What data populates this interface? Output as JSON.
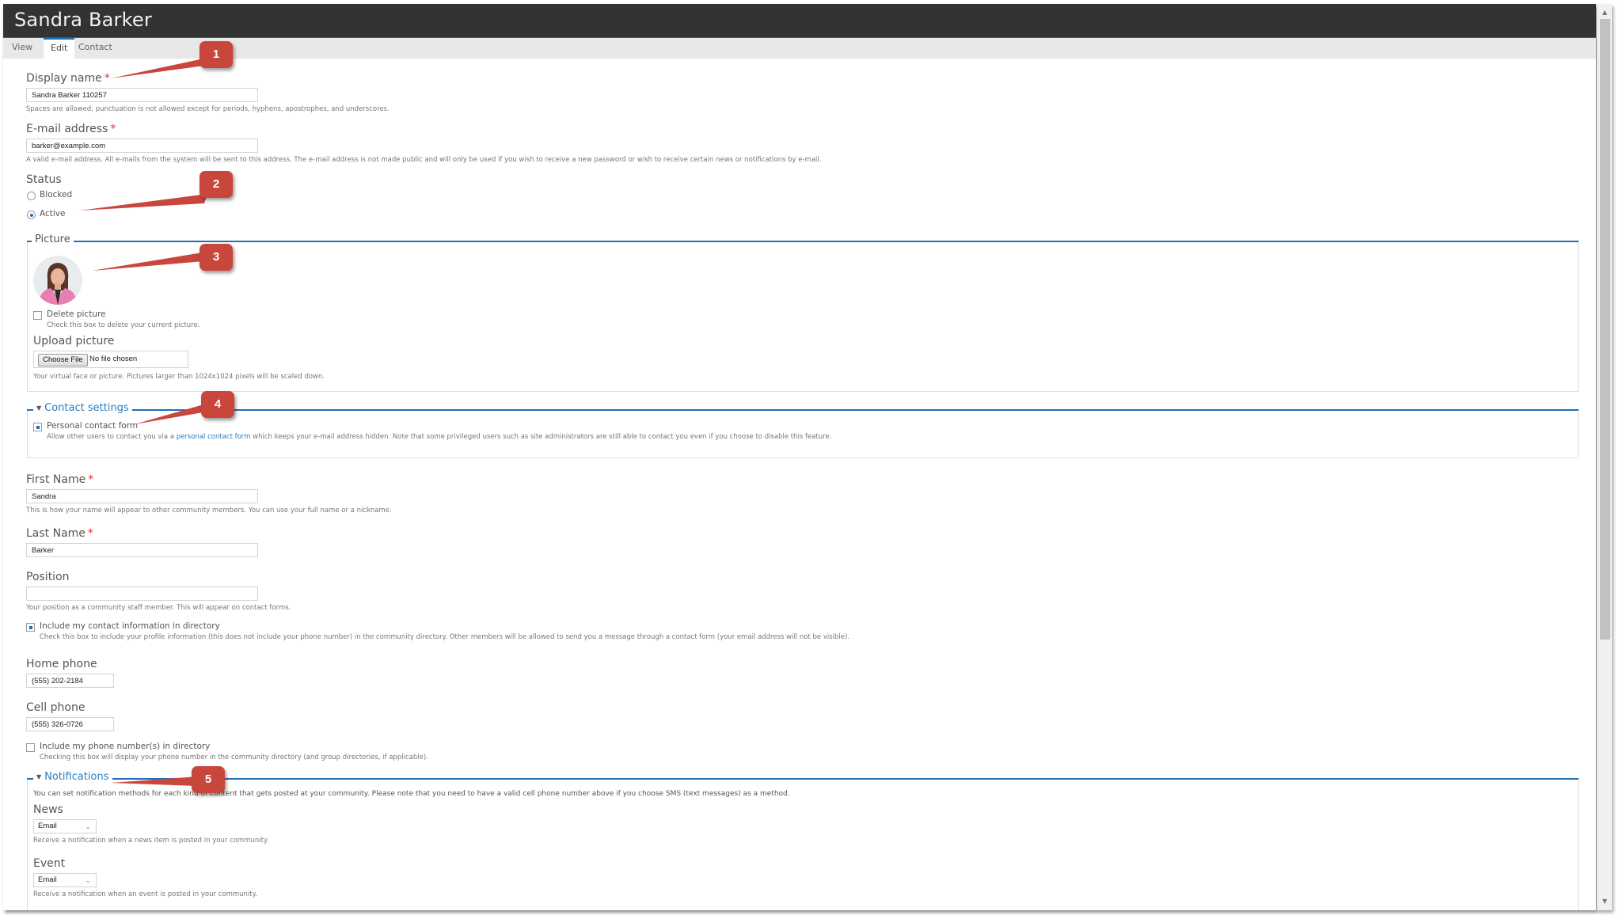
{
  "header": {
    "title": "Sandra Barker"
  },
  "tabs": [
    {
      "label": "View",
      "active": false
    },
    {
      "label": "Edit",
      "active": true
    },
    {
      "label": "Contact",
      "active": false
    }
  ],
  "form": {
    "display_name": {
      "label": "Display name",
      "required": "*",
      "value": "Sandra Barker 110257",
      "description": "Spaces are allowed; punctuation is not allowed except for periods, hyphens, apostrophes, and underscores."
    },
    "email": {
      "label": "E-mail address",
      "required": "*",
      "value": "barker@example.com",
      "description": "A valid e-mail address. All e-mails from the system will be sent to this address. The e-mail address is not made public and will only be used if you wish to receive a new password or wish to receive certain news or notifications by e-mail."
    },
    "status": {
      "label": "Status",
      "options": [
        {
          "label": "Blocked",
          "checked": false
        },
        {
          "label": "Active",
          "checked": true
        }
      ]
    },
    "picture": {
      "legend": "Picture",
      "delete_label": "Delete picture",
      "delete_checked": false,
      "delete_description": "Check this box to delete your current picture.",
      "upload_label": "Upload picture",
      "choose_button": "Choose File",
      "no_file": "No file chosen",
      "upload_description": "Your virtual face or picture. Pictures larger than 1024x1024 pixels will be scaled down."
    },
    "contact_settings": {
      "legend": "Contact settings",
      "personal_form_label": "Personal contact form",
      "personal_form_checked": true,
      "description_before": "Allow other users to contact you via a ",
      "description_link": "personal contact form",
      "description_after": " which keeps your e-mail address hidden. Note that some privileged users such as site administrators are still able to contact you even if you choose to disable this feature."
    },
    "first_name": {
      "label": "First Name",
      "required": "*",
      "value": "Sandra",
      "description": "This is how your name will appear to other community members. You can use your full name or a nickname."
    },
    "last_name": {
      "label": "Last Name",
      "required": "*",
      "value": "Barker"
    },
    "position": {
      "label": "Position",
      "value": "",
      "description": "Your position as a community staff member. This will appear on contact forms."
    },
    "include_contact": {
      "label": "Include my contact information in directory",
      "checked": true,
      "description": "Check this box to include your profile information (this does not include your phone number) in the community directory. Other members will be allowed to send you a message through a contact form (your email address will not be visible)."
    },
    "home_phone": {
      "label": "Home phone",
      "value": "(555) 202-2184"
    },
    "cell_phone": {
      "label": "Cell phone",
      "value": "(555) 326-0726"
    },
    "include_phone": {
      "label": "Include my phone number(s) in directory",
      "checked": false,
      "description": "Checking this box will display your phone number in the community directory (and group directories, if applicable)."
    },
    "notifications": {
      "legend": "Notifications",
      "intro": "You can set notification methods for each kind of content that gets posted at your community. Please note that you need to have a valid cell phone number above if you choose SMS (text messages) as a method.",
      "news": {
        "label": "News",
        "value": "Email",
        "description": "Receive a notification when a news item is posted in your community."
      },
      "event": {
        "label": "Event",
        "value": "Email",
        "description": "Receive a notification when an event is posted in your community."
      }
    }
  },
  "callouts": [
    "1",
    "2",
    "3",
    "4",
    "5"
  ],
  "colors": {
    "header_bg": "#333333",
    "accent": "#1f6fb5",
    "callout": "#c9463d",
    "required": "#e2302d"
  }
}
